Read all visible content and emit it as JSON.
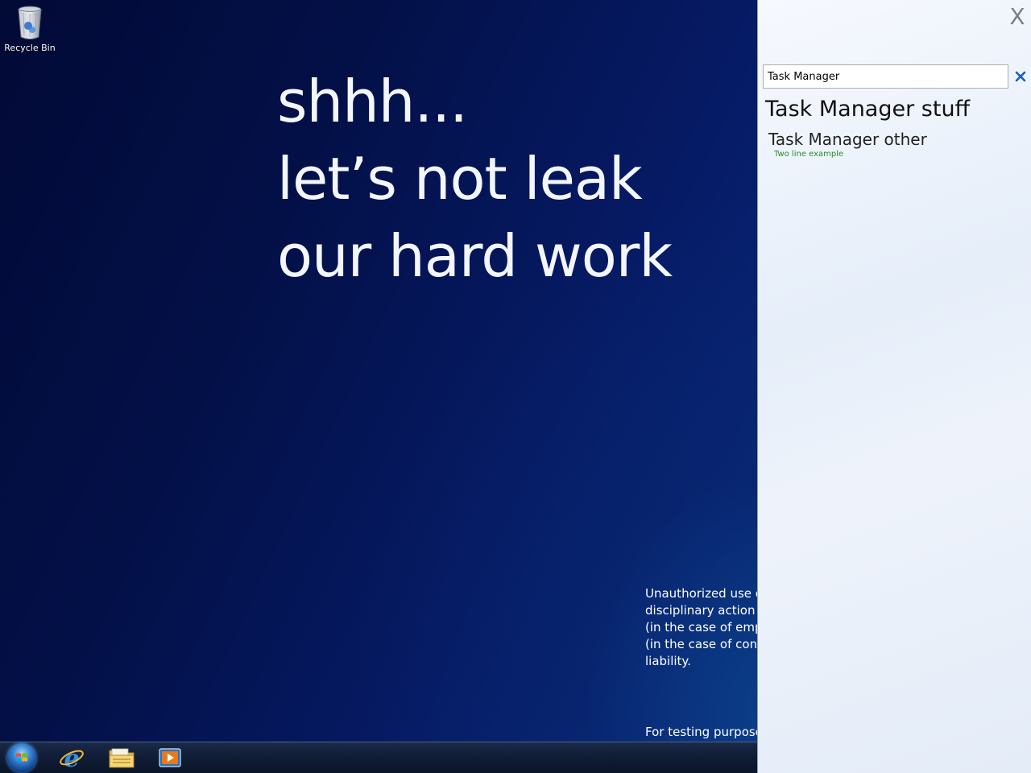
{
  "desktop": {
    "icons": [
      {
        "label": "Recycle Bin",
        "icon": "recycle-bin-icon"
      }
    ],
    "slogan": [
      "shhh...",
      "let’s not leak",
      "our hard work"
    ],
    "legal_lines": [
      "Unauthorized use o",
      "disciplinary action u",
      "(in the case of emplo",
      "(in the case of contin",
      "liability."
    ],
    "testing_note": "For testing purposes"
  },
  "taskbar": {
    "items": [
      {
        "name": "start-button",
        "icon": "windows-start-orb-icon"
      },
      {
        "name": "internet-explorer",
        "icon": "internet-explorer-icon"
      },
      {
        "name": "windows-explorer",
        "icon": "folder-icon"
      },
      {
        "name": "media-player",
        "icon": "media-player-icon"
      }
    ]
  },
  "search_panel": {
    "close_label": "X",
    "query": "Task Manager",
    "clear_icon": "clear-x-icon",
    "results": [
      {
        "title": "Task Manager stuff"
      },
      {
        "title": "Task Manager other",
        "subtitle": "Two line example"
      }
    ],
    "colors": {
      "subtitle": "#2a8a2a",
      "clear": "#1e5fb4"
    }
  }
}
